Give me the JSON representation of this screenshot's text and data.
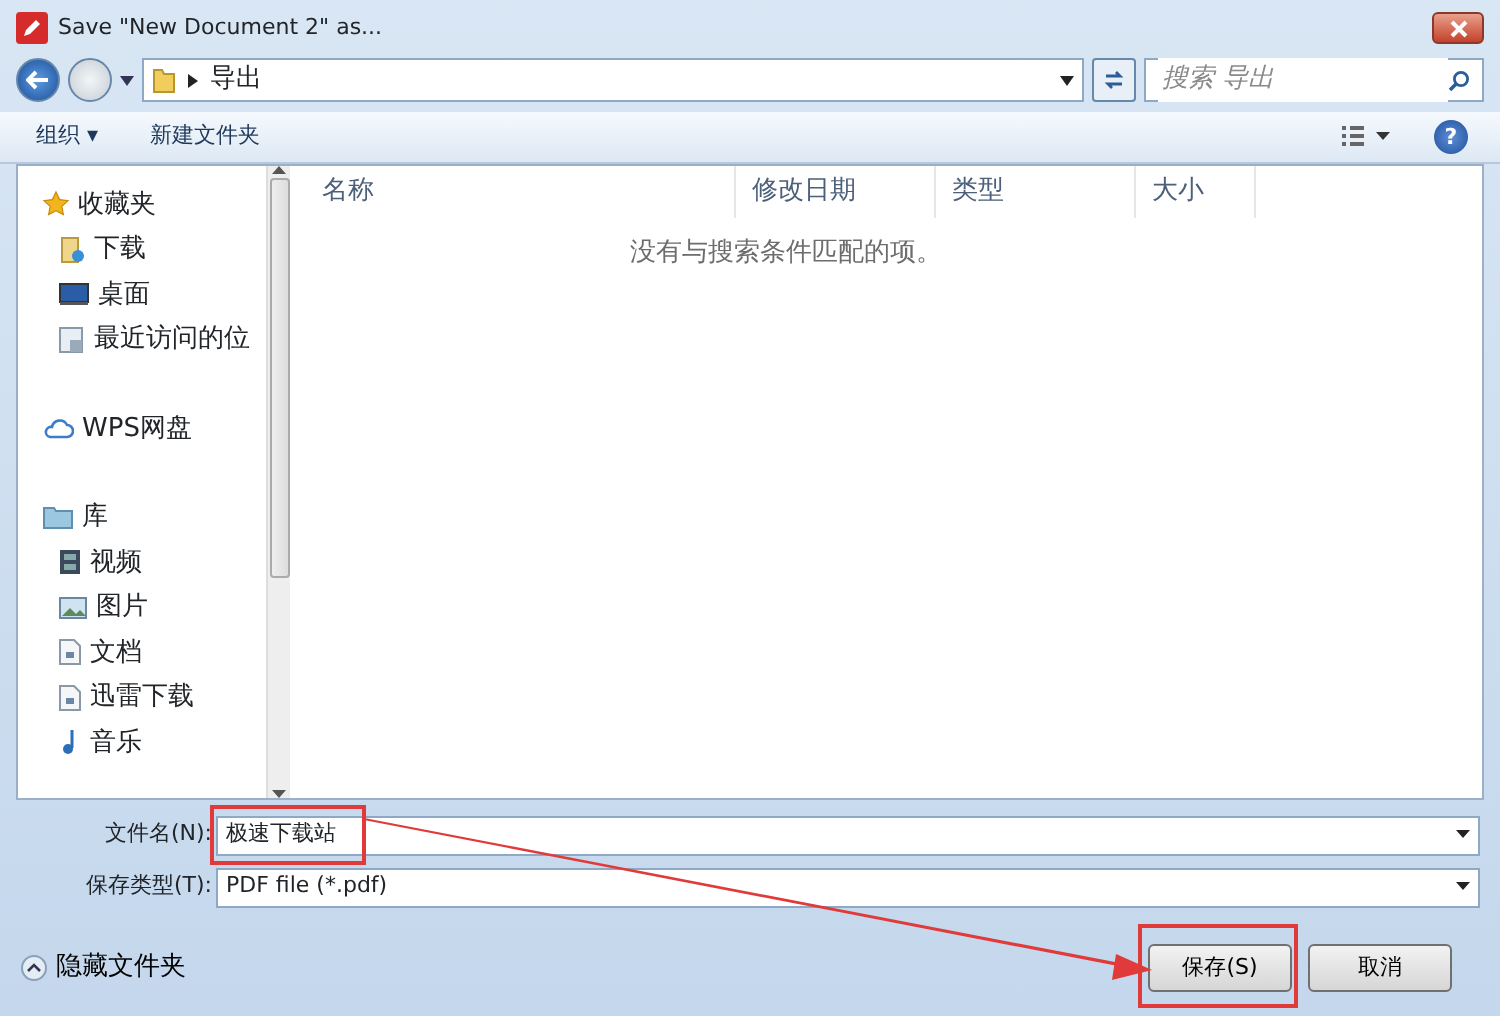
{
  "window": {
    "title": "Save \"New Document 2\" as..."
  },
  "address_bar": {
    "path": "导出",
    "search_placeholder": "搜索 导出"
  },
  "toolbar": {
    "organize": "组织 ▾",
    "new_folder": "新建文件夹",
    "help": "?"
  },
  "sidebar": {
    "groups": [
      {
        "label": "收藏夹",
        "children": [
          {
            "label": "下载"
          },
          {
            "label": "桌面"
          },
          {
            "label": "最近访问的位"
          }
        ]
      },
      {
        "label": "WPS网盘"
      },
      {
        "label": "库",
        "children": [
          {
            "label": "视频"
          },
          {
            "label": "图片"
          },
          {
            "label": "文档"
          },
          {
            "label": "迅雷下载"
          },
          {
            "label": "音乐"
          }
        ]
      }
    ]
  },
  "file_list": {
    "columns": [
      "名称",
      "修改日期",
      "类型",
      "大小"
    ],
    "empty_message": "没有与搜索条件匹配的项。"
  },
  "file_name": {
    "label": "文件名(N):",
    "value": "极速下载站"
  },
  "file_type": {
    "label": "保存类型(T):",
    "value": "PDF file (*.pdf)"
  },
  "hide_folders": "隐藏文件夹",
  "buttons": [
    "保存(S)",
    "取消"
  ],
  "annotation": {
    "highlight_boxes": true,
    "arrow": true
  }
}
